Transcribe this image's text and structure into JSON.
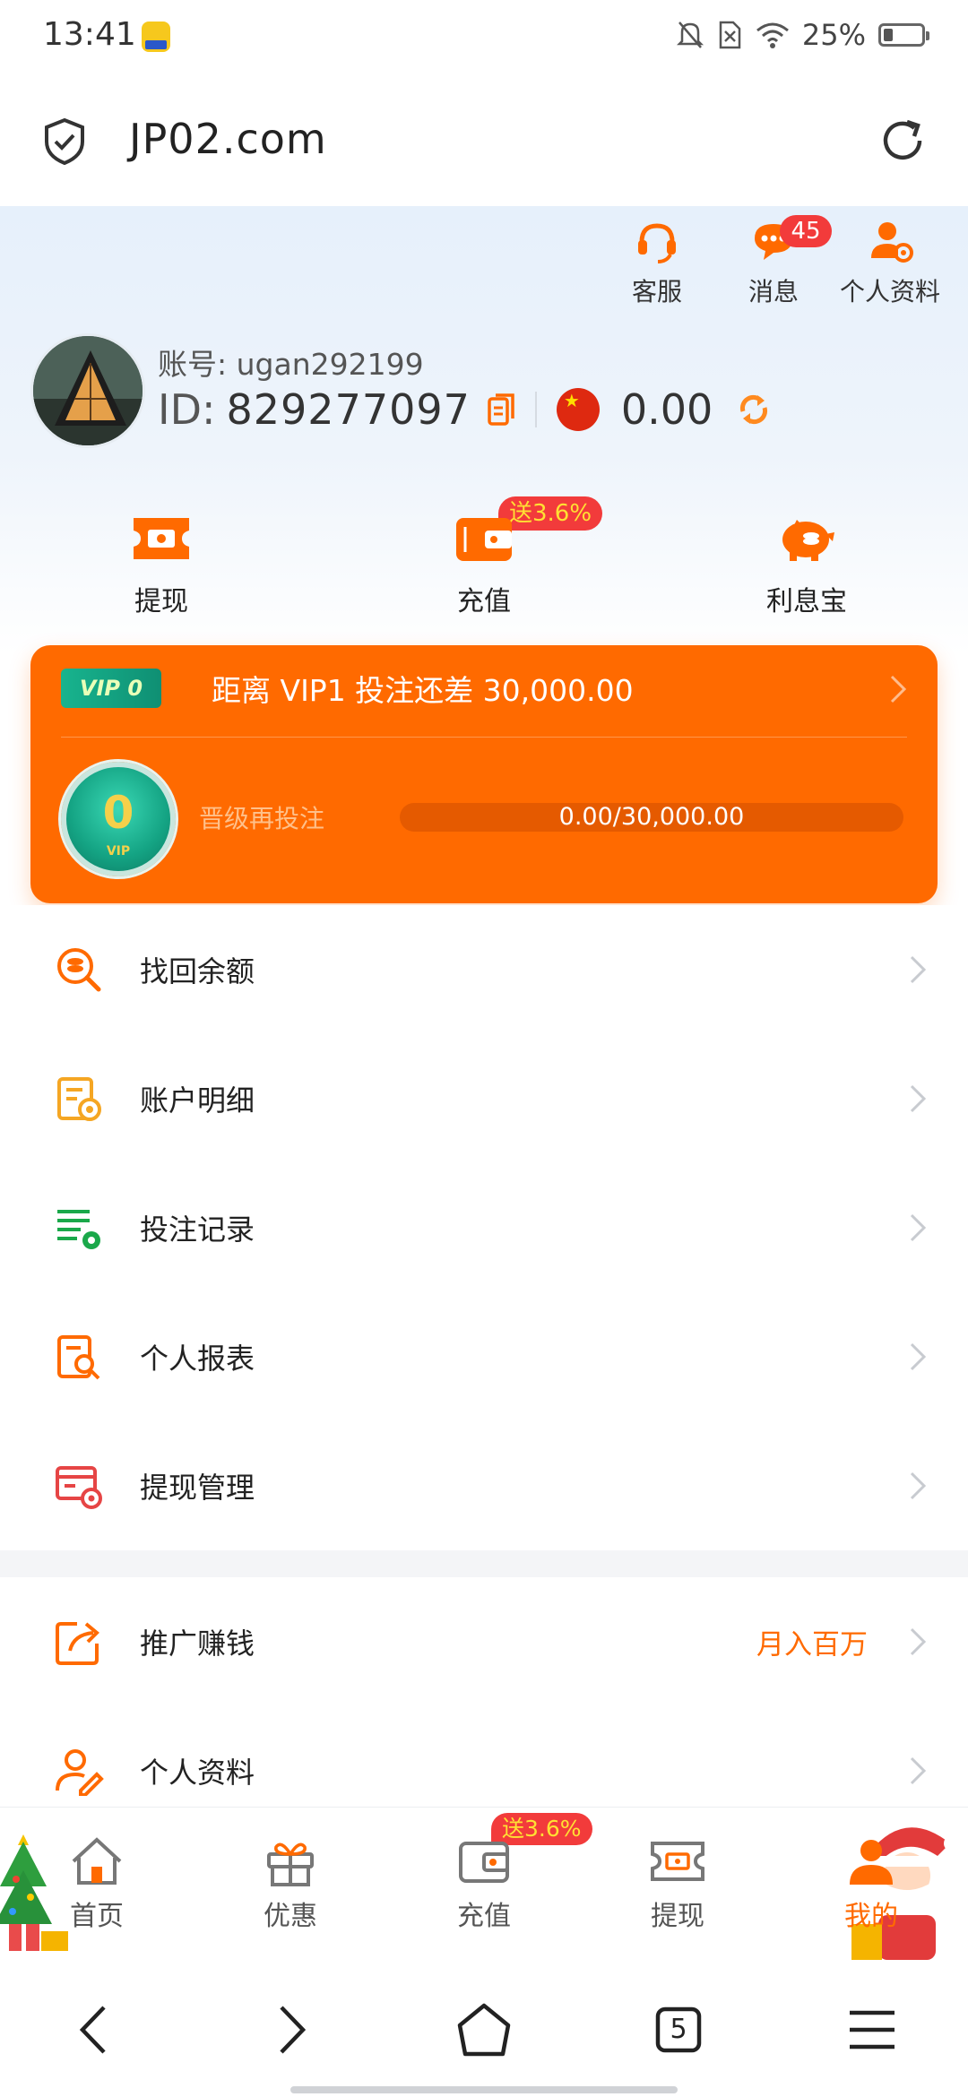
{
  "status_bar": {
    "time": "13:41",
    "battery_pct": "25%"
  },
  "browser": {
    "url": "JP02.com"
  },
  "top_actions": [
    {
      "label": "客服"
    },
    {
      "label": "消息",
      "badge": "45"
    },
    {
      "label": "个人资料"
    }
  ],
  "profile": {
    "account_label": "账号: ugan292199",
    "id_label": "ID:",
    "id_value": "829277097",
    "balance": "0.00"
  },
  "quick_actions": [
    {
      "label": "提现"
    },
    {
      "label": "充值",
      "badge": "送3.6%"
    },
    {
      "label": "利息宝"
    }
  ],
  "vip": {
    "tag": "VIP 0",
    "title": "距离  VIP1  投注还差 30,000.00",
    "level": "0",
    "badge_text": "VIP",
    "hint": "晋级再投注",
    "progress_text": "0.00/30,000.00",
    "progress_fraction": 0.0
  },
  "menu_group_1": [
    {
      "label": "找回余额",
      "icon": "coin-search-icon"
    },
    {
      "label": "账户明细",
      "icon": "account-detail-icon"
    },
    {
      "label": "投注记录",
      "icon": "bet-record-icon"
    },
    {
      "label": "个人报表",
      "icon": "report-icon"
    },
    {
      "label": "提现管理",
      "icon": "withdraw-manage-icon"
    }
  ],
  "menu_group_2": [
    {
      "label": "推广赚钱",
      "extra": "月入百万",
      "icon": "share-icon"
    },
    {
      "label": "个人资料",
      "icon": "user-edit-icon"
    }
  ],
  "tab_bar": [
    {
      "label": "首页"
    },
    {
      "label": "优惠"
    },
    {
      "label": "充值",
      "badge": "送3.6%"
    },
    {
      "label": "提现"
    },
    {
      "label": "我的"
    }
  ],
  "nav": {
    "tabs_count": "5"
  },
  "colors": {
    "brand_orange": "#ff6a00",
    "badge_red": "#f23b3b",
    "vip_green": "#14a383"
  }
}
